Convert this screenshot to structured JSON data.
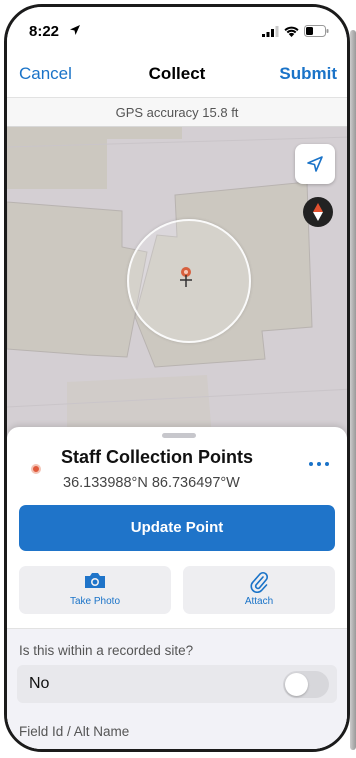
{
  "status_bar": {
    "time": "8:22"
  },
  "nav": {
    "cancel_label": "Cancel",
    "title": "Collect",
    "submit_label": "Submit"
  },
  "gps": {
    "accuracy_text": "GPS accuracy 15.8 ft"
  },
  "map": {
    "nav_button_icon": "location-arrow-icon",
    "compass_icon": "compass-icon"
  },
  "sheet": {
    "layer_name": "Staff Collection Points",
    "coordinates": "36.133988°N  86.736497°W",
    "update_button": "Update Point",
    "take_photo_label": "Take Photo",
    "attach_label": "Attach"
  },
  "form": {
    "question": "Is this within a recorded site?",
    "toggle_value": "No",
    "field_label": "Field Id / Alt Name"
  },
  "colors": {
    "accent": "#1a73c8",
    "button": "#1f74c9",
    "layer_dot": "#e05a3c"
  }
}
